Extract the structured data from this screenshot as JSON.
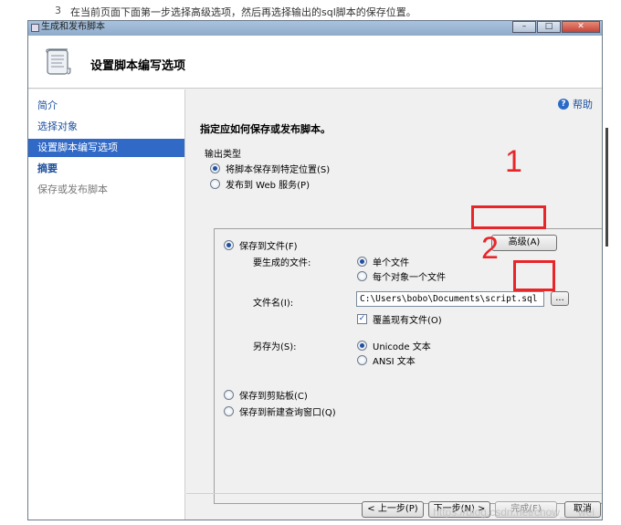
{
  "caption": {
    "step_number": "3",
    "text": "在当前页面下面第一步选择高级选项，然后再选择输出的sql脚本的保存位置。"
  },
  "window": {
    "title": "生成和发布脚本",
    "header_title": "设置脚本编写选项"
  },
  "sidebar": {
    "items": [
      {
        "label": "简介"
      },
      {
        "label": "选择对象"
      },
      {
        "label": "设置脚本编写选项"
      },
      {
        "label": "摘要"
      },
      {
        "label": "保存或发布脚本"
      }
    ]
  },
  "content": {
    "help_label": "帮助",
    "instruction": "指定应如何保存或发布脚本。",
    "output_type": {
      "label": "输出类型",
      "options": [
        {
          "label": "将脚本保存到特定位置(S)",
          "checked": true
        },
        {
          "label": "发布到 Web 服务(P)",
          "checked": false
        }
      ]
    },
    "save_to_file": {
      "label": "保存到文件(F)",
      "checked": true,
      "advanced_button": "高级(A)",
      "files_to_generate_label": "要生成的文件:",
      "files_options": [
        {
          "label": "单个文件",
          "checked": true
        },
        {
          "label": "每个对象一个文件",
          "checked": false
        }
      ],
      "filename_label": "文件名(I):",
      "filename_value": "C:\\Users\\bobo\\Documents\\script.sql",
      "browse_button": "...",
      "overwrite_label": "覆盖现有文件(O)",
      "overwrite_checked": true,
      "save_as_label": "另存为(S):",
      "save_as_options": [
        {
          "label": "Unicode 文本",
          "checked": true
        },
        {
          "label": "ANSI 文本",
          "checked": false
        }
      ]
    },
    "save_to_clipboard": {
      "label": "保存到剪贴板(C)",
      "checked": false
    },
    "save_to_query_window": {
      "label": "保存到新建查询窗口(Q)",
      "checked": false
    }
  },
  "annotations": {
    "num1": "1",
    "num2": "2"
  },
  "footer": {
    "prev_button": "< 上一步(P)",
    "next_button": "下一步(N) >",
    "finish_button": "完成(F)",
    "cancel_button": "取消"
  },
  "watermark": "https://blog.csdn.net/chow___wei"
}
